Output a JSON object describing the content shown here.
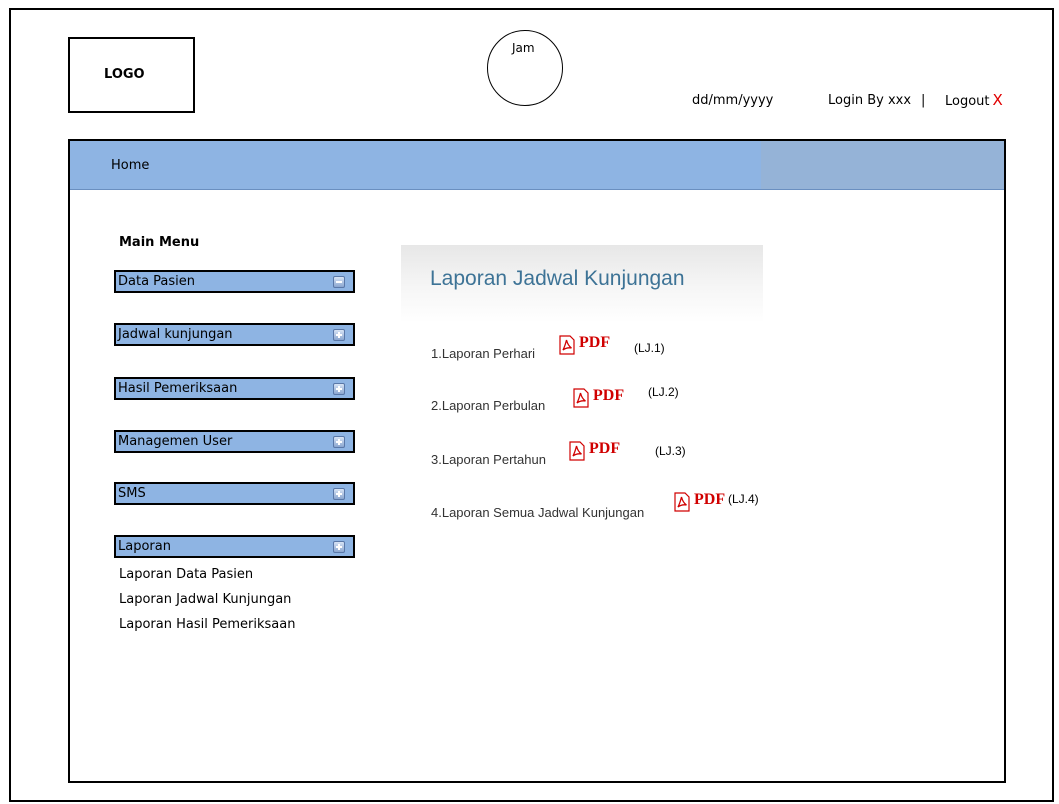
{
  "header": {
    "logo": "LOGO",
    "clock": "Jam",
    "date": "dd/mm/yyyy",
    "login": "Login By xxx",
    "separator": "|",
    "logout": "Logout",
    "logout_x": "X"
  },
  "nav": {
    "home": "Home"
  },
  "sidebar": {
    "title": "Main Menu",
    "items": [
      {
        "label": "Data Pasien",
        "icon": "minus-icon"
      },
      {
        "label": "Jadwal kunjungan",
        "icon": "plus-icon"
      },
      {
        "label": "Hasil Pemeriksaan",
        "icon": "plus-icon"
      },
      {
        "label": "Managemen User",
        "icon": "plus-icon"
      },
      {
        "label": "SMS",
        "icon": "plus-icon"
      },
      {
        "label": "Laporan",
        "icon": "plus-icon"
      }
    ],
    "subitems": [
      "Laporan Data Pasien",
      "Laporan Jadwal Kunjungan",
      "Laporan Hasil Pemeriksaan"
    ]
  },
  "main": {
    "title": "Laporan Jadwal Kunjungan",
    "pdf_label": "PDF",
    "reports": [
      {
        "label": "1.Laporan Perhari",
        "code": "(LJ.1)"
      },
      {
        "label": "2.Laporan Perbulan",
        "code": "(LJ.2)"
      },
      {
        "label": "3.Laporan Pertahun",
        "code": "(LJ.3)"
      },
      {
        "label": "4.Laporan Semua Jadwal Kunjungan",
        "code": "(LJ.4)"
      }
    ]
  },
  "colors": {
    "menu_bg": "#8eb4e3",
    "nav_bg": "#8eb4e3",
    "title": "#3d7396",
    "pdf": "#d00000",
    "logout_x": "#e00000"
  }
}
